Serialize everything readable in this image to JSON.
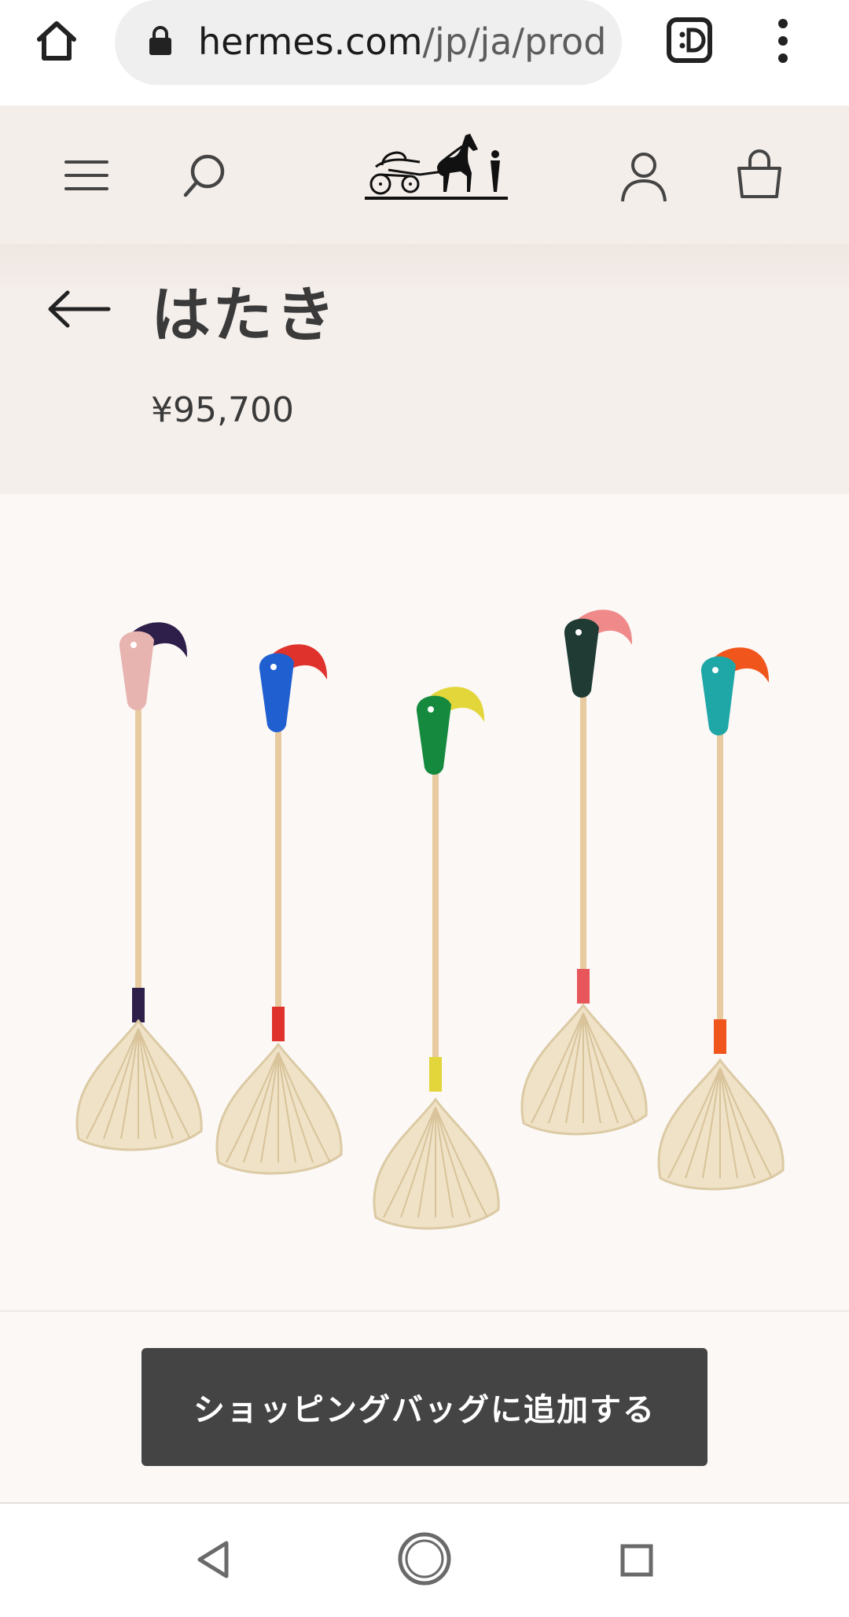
{
  "browser": {
    "url_domain": "hermes.com",
    "url_path": "/jp/ja/produ"
  },
  "product": {
    "title": "はたき",
    "price": "¥95,700"
  },
  "add_to_bag": {
    "label": "ショッピングバッグに追加する"
  },
  "dusters": [
    {
      "handle": "#e8b4b0",
      "beak": "#2e1f4a",
      "band": "#2e1f4a"
    },
    {
      "handle": "#1f5fd0",
      "beak": "#e0322c",
      "band": "#e0322c"
    },
    {
      "handle": "#158a3e",
      "beak": "#e2d63a",
      "band": "#e2d63a"
    },
    {
      "handle": "#1f3b34",
      "beak": "#f08a8a",
      "band": "#e8555a"
    },
    {
      "handle": "#1fa6a6",
      "beak": "#f0561c",
      "band": "#f0561c"
    }
  ],
  "icons": {
    "home": "home-icon",
    "lock": "lock-icon",
    "extension": "extension-icon",
    "overflow": "more-vert-icon",
    "menu": "hamburger-menu-icon",
    "search": "search-icon",
    "logo": "hermes-carriage-logo",
    "account": "account-icon",
    "bag": "shopping-bag-icon",
    "back": "back-arrow-icon"
  }
}
